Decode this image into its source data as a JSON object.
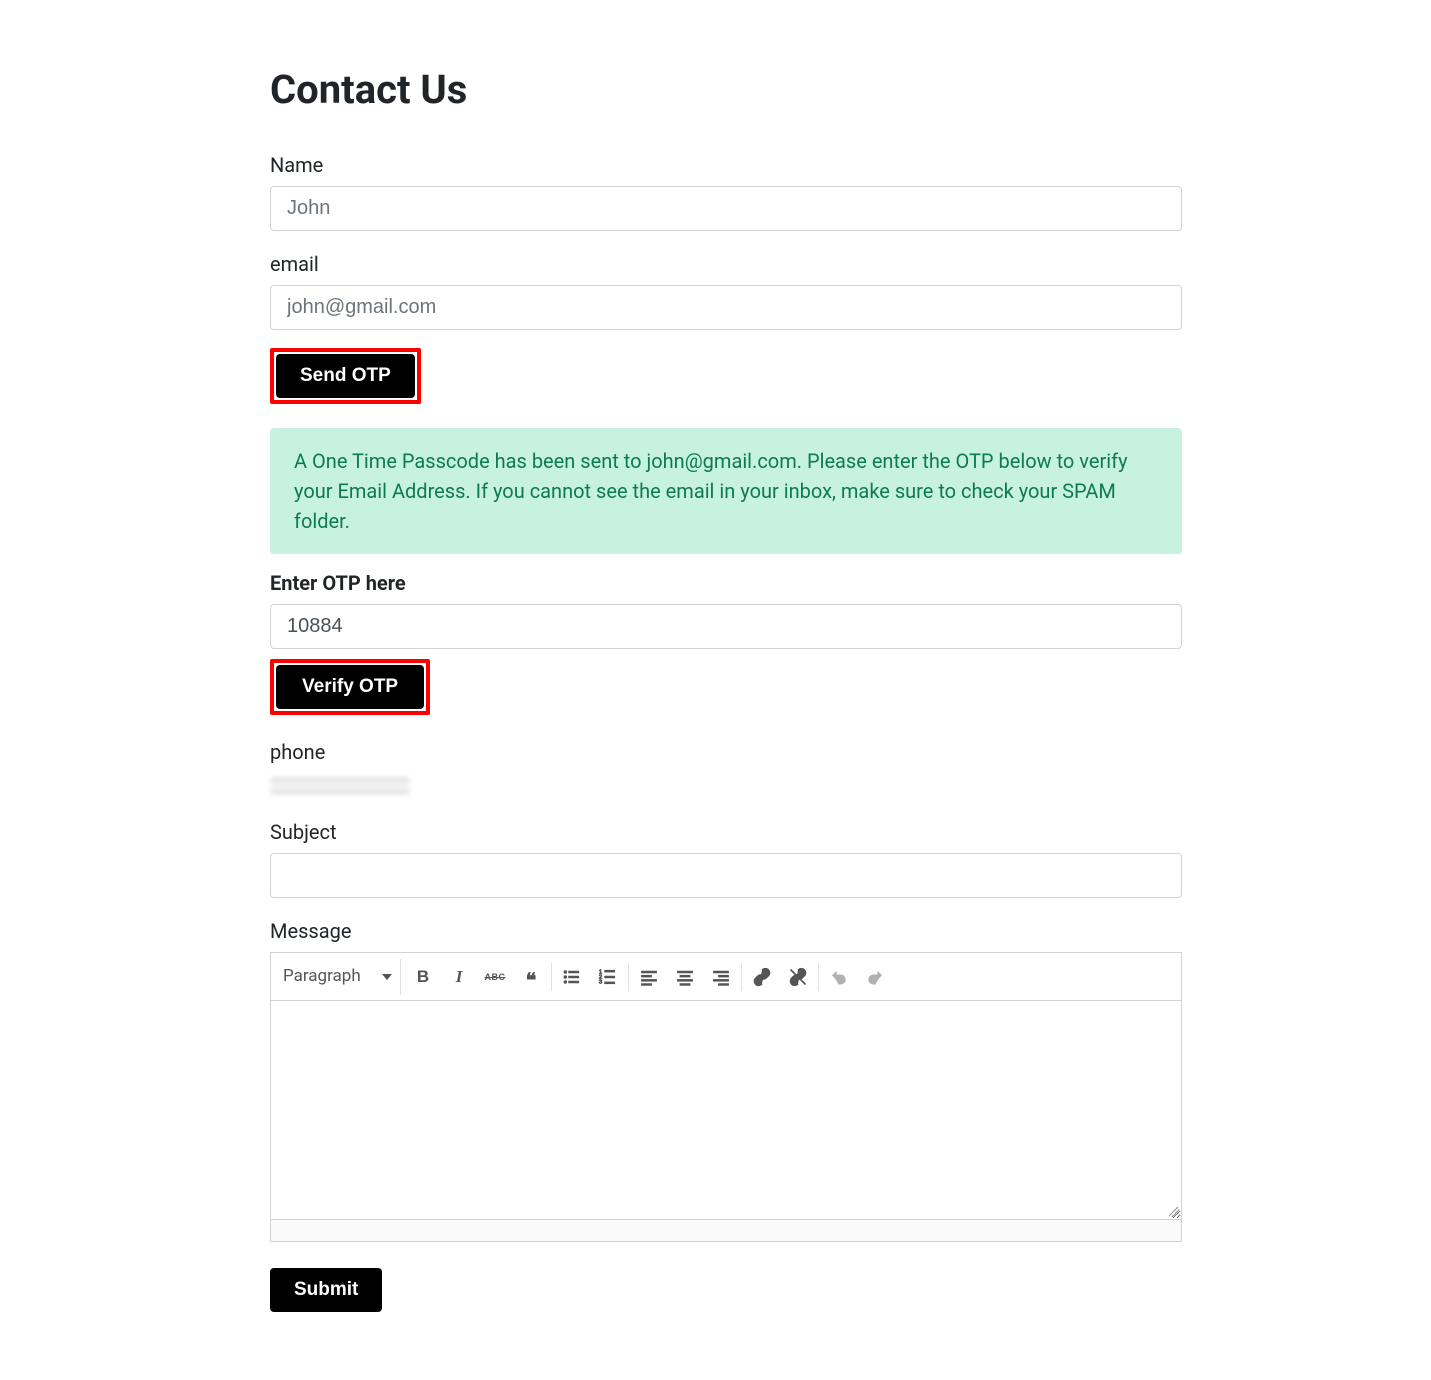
{
  "page": {
    "title": "Contact Us"
  },
  "fields": {
    "name": {
      "label": "Name",
      "placeholder": "John",
      "value": ""
    },
    "email": {
      "label": "email",
      "placeholder": "john@gmail.com",
      "value": ""
    },
    "otp": {
      "label": "Enter OTP here",
      "value": "10884"
    },
    "phone": {
      "label": "phone",
      "value": ""
    },
    "subject": {
      "label": "Subject",
      "value": ""
    },
    "message": {
      "label": "Message"
    }
  },
  "buttons": {
    "send_otp": "Send OTP",
    "verify_otp": "Verify OTP",
    "submit": "Submit"
  },
  "alert": {
    "text": "A One Time Passcode has been sent to john@gmail.com. Please enter the OTP below to verify your Email Address. If you cannot see the email in your inbox, make sure to check your SPAM folder."
  },
  "editor": {
    "format_label": "Paragraph"
  }
}
